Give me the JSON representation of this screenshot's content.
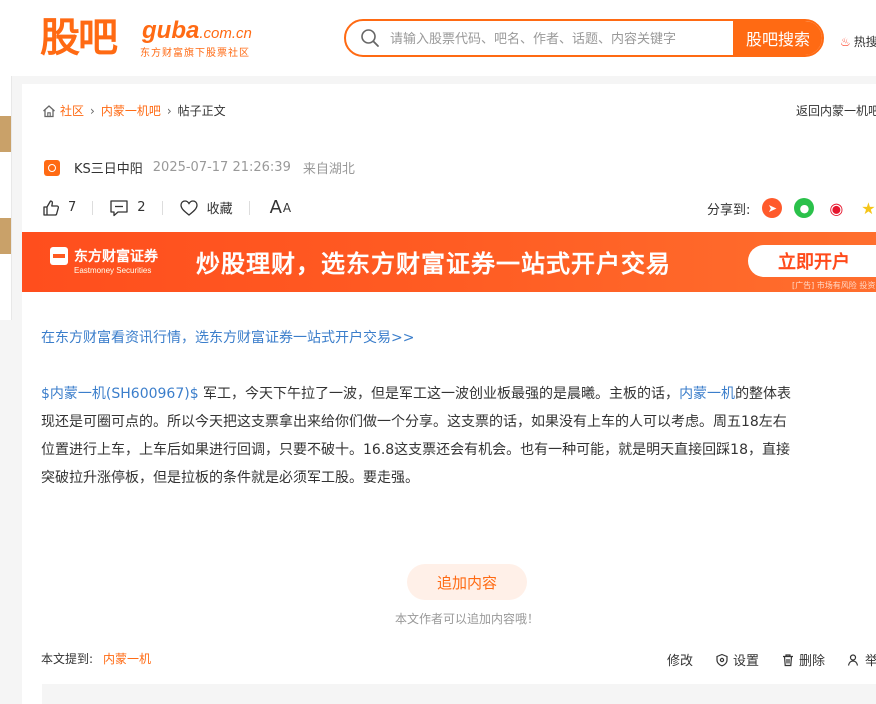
{
  "header": {
    "logo_cn": "股吧",
    "logo_en": "guba",
    "logo_domain": ".com.cn",
    "logo_sub": "东方财富旗下股票社区",
    "search_placeholder": "请输入股票代码、吧名、作者、话题、内容关键字",
    "search_button": "股吧搜索",
    "hot_label": "热搜"
  },
  "breadcrumb": {
    "home": "社区",
    "forum": "内蒙一机吧",
    "current": "帖子正文",
    "back": "返回内蒙一机吧"
  },
  "post": {
    "author": "KS三日中阳",
    "time": "2025-07-17 21:26:39",
    "location": "来自湖北",
    "likes": "7",
    "comments": "2",
    "favorite": "收藏",
    "font_big": "A",
    "font_small": "A",
    "share_label": "分享到:"
  },
  "banner": {
    "brand": "东方财富证券",
    "brand_en": "Eastmoney Securities",
    "title": "炒股理财，选东方财富证券一站式开户交易",
    "button": "立即开户",
    "note": "[广告] 市场有风险 投资需谨慎"
  },
  "promo_link": "在东方财富看资讯行情，选东方财富证券一站式开户交易>>",
  "content": {
    "stock_link": "$内蒙一机(SH600967)$",
    "line1_a": " 军工，今天下午拉了一波，但是军工这一波创业板最强的是晨曦。主板的话，",
    "line1_link": "内蒙一机",
    "line1_b": "的整体表",
    "line2": "现还是可圈可点的。所以今天把这支票拿出来给你们做一个分享。这支票的话，如果没有上车的人可以考虑。周五18左右",
    "line3": "位置进行上车，上车后如果进行回调，只要不破十。16.8这支票还会有机会。也有一种可能，就是明天直接回踩18，直接",
    "line4": "突破拉升涨停板，但是拉板的条件就是必须军工股。要走强。"
  },
  "append": {
    "button": "追加内容",
    "hint": "本文作者可以追加内容哦！"
  },
  "footer": {
    "mention_label": "本文提到:",
    "mention_link": "内蒙一机",
    "edit": "修改",
    "settings": "设置",
    "delete": "删除",
    "report": "举报"
  },
  "colors": {
    "brand": "#ff6a13",
    "link": "#3b7ecb",
    "banner": "#ff5a21"
  }
}
